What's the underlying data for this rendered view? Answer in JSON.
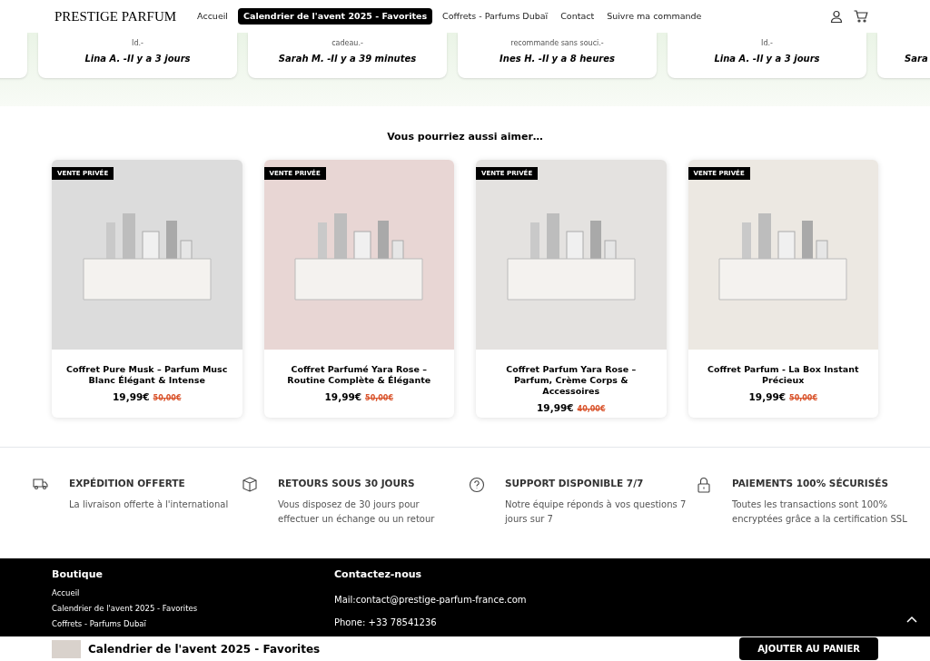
{
  "header": {
    "logo": "PRESTIGE PARFUM",
    "nav": [
      {
        "label": "Accueil",
        "selected": false
      },
      {
        "label": "Calendrier de l'avent 2025 - Favorites",
        "selected": true
      },
      {
        "label": "Coffrets - Parfums Dubaï",
        "selected": false
      },
      {
        "label": "Contact",
        "selected": false
      },
      {
        "label": "Suivre ma commande",
        "selected": false
      }
    ]
  },
  "reviews": [
    {
      "snippet": "Id.-",
      "author": "Lina A. -Il y a 3 jours"
    },
    {
      "snippet": "cadeau.-",
      "author": "Sarah M. -Il y a 39 minutes"
    },
    {
      "snippet": "recommande sans souci.-",
      "author": "Ines H. -Il y a 8 heures"
    },
    {
      "snippet": "Id.-",
      "author": "Lina A. -Il y a 3 jours"
    },
    {
      "author": "Sara"
    }
  ],
  "related": {
    "title": "Vous pourriez aussi aimer…",
    "products": [
      {
        "badge": "VENTE PRIVÉE",
        "name": "Coffret Pure Musk – Parfum Musc Blanc Élégant & Intense",
        "price": "19,99€",
        "old_price": "50,00€"
      },
      {
        "badge": "VENTE PRIVÉE",
        "name": "Coffret Parfumé Yara Rose – Routine Complète & Élégante",
        "price": "19,99€",
        "old_price": "50,00€"
      },
      {
        "badge": "VENTE PRIVÉE",
        "name": "Coffret Parfum Yara Rose – Parfum, Crème Corps & Accessoires",
        "price": "19,99€",
        "old_price": "40,00€"
      },
      {
        "badge": "VENTE PRIVÉE",
        "name": "Coffret Parfum - La Box Instant Précieux",
        "price": "19,99€",
        "old_price": "50,00€"
      }
    ]
  },
  "features": [
    {
      "kind": "truck",
      "title": "EXPÉDITION OFFERTE",
      "text": "La livraison offerte à l'international"
    },
    {
      "kind": "box",
      "title": "RETOURS SOUS 30 JOURS",
      "text": "Vous disposez de 30 jours pour effectuer un échange ou un retour"
    },
    {
      "kind": "help",
      "title": "SUPPORT DISPONIBLE 7/7",
      "text": "Notre équipe réponds à vos questions 7 jours sur 7"
    },
    {
      "kind": "lock",
      "title": "PAIEMENTS 100% SÉCURISÉS",
      "text": "Toutes les transactions sont 100% encryptées grâce a la certification SSL"
    }
  ],
  "footer": {
    "shop_title": "Boutique",
    "shop_links": [
      "Accueil",
      "Calendrier de l'avent 2025 - Favorites",
      "Coffrets - Parfums Dubaï"
    ],
    "contact_title": "Contactez-nous",
    "contact_lines": [
      "Mail:contact@prestige-parfum-france.com",
      "Phone: +33 78541236"
    ]
  },
  "sticky_bar": {
    "title": "Calendrier de l'avent 2025 - Favorites",
    "button": "AJOUTER AU PANIER"
  }
}
